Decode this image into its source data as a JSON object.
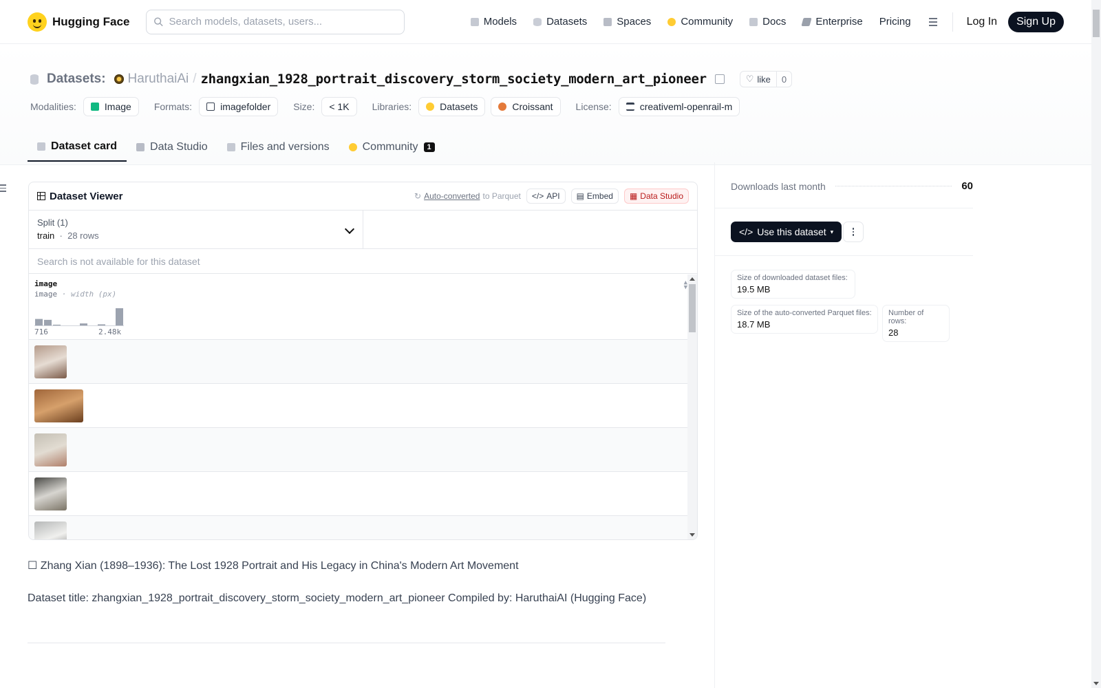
{
  "nav": {
    "brand": "Hugging Face",
    "search_placeholder": "Search models, datasets, users...",
    "links": [
      {
        "label": "Models",
        "icon": "models-icon"
      },
      {
        "label": "Datasets",
        "icon": "datasets-icon"
      },
      {
        "label": "Spaces",
        "icon": "spaces-icon"
      },
      {
        "label": "Community",
        "icon": "community-icon"
      },
      {
        "label": "Docs",
        "icon": "docs-icon"
      },
      {
        "label": "Enterprise",
        "icon": "enterprise-icon"
      },
      {
        "label": "Pricing",
        "icon": ""
      }
    ],
    "login": "Log In",
    "signup": "Sign Up"
  },
  "header": {
    "crumb_label": "Datasets:",
    "owner": "HaruthaiAi",
    "separator": "/",
    "repo": "zhangxian_1928_portrait_discovery_storm_society_modern_art_pioneer",
    "like_label": "like",
    "like_count": "0"
  },
  "tags": {
    "modalities_label": "Modalities:",
    "modality": "Image",
    "formats_label": "Formats:",
    "format": "imagefolder",
    "size_label": "Size:",
    "size": "< 1K",
    "libraries_label": "Libraries:",
    "libraries": [
      "Datasets",
      "Croissant"
    ],
    "license_label": "License:",
    "license": "creativeml-openrail-m"
  },
  "tabs": [
    {
      "label": "Dataset card",
      "active": true
    },
    {
      "label": "Data Studio",
      "active": false
    },
    {
      "label": "Files and versions",
      "active": false
    },
    {
      "label": "Community",
      "active": false,
      "badge": "1"
    }
  ],
  "viewer": {
    "title": "Dataset Viewer",
    "auto_converted": "Auto-converted",
    "to_parquet": "to Parquet",
    "api": "API",
    "embed": "Embed",
    "data_studio": "Data Studio",
    "split_label": "Split (1)",
    "split_value": "train",
    "split_dot": "·",
    "rows_label": "28 rows",
    "search_disabled": "Search is not available for this dataset",
    "column": {
      "name": "image",
      "type": "image",
      "stat": "· width (px)",
      "min_label": "716",
      "max_label": "2.48k",
      "histogram": [
        0.4,
        0.35,
        0.08,
        0,
        0,
        0.15,
        0,
        0.1,
        0,
        1.0
      ]
    },
    "thumbnails": [
      {
        "width": 47,
        "colors": [
          "#b49a8a",
          "#e6dcd3",
          "#7b5a48"
        ]
      },
      {
        "width": 71,
        "colors": [
          "#a0663a",
          "#d6a06b",
          "#6a3e1e"
        ]
      },
      {
        "width": 47,
        "colors": [
          "#c4bfb4",
          "#e2dcd2",
          "#b07f6a"
        ]
      },
      {
        "width": 47,
        "colors": [
          "#4a4a46",
          "#d7d5d0",
          "#7b7466"
        ]
      },
      {
        "width": 47,
        "colors": [
          "#b6b8b8",
          "#f0f0ee",
          "#707070"
        ]
      }
    ]
  },
  "card": {
    "line1": "☐ Zhang Xian (1898–1936): The Lost 1928 Portrait and His Legacy in China's Modern Art Movement",
    "line2": "Dataset title: zhangxian_1928_portrait_discovery_storm_society_modern_art_pioneer Compiled by: HaruthaiAI (Hugging Face)"
  },
  "sidebar": {
    "downloads_label": "Downloads last month",
    "downloads_value": "60",
    "use_button": "Use this dataset",
    "stats": [
      {
        "label": "Size of downloaded dataset files:",
        "value": "19.5 MB"
      },
      {
        "label": "Size of the auto-converted Parquet files:",
        "value": "18.7 MB"
      },
      {
        "label": "Number of rows:",
        "value": "28"
      }
    ]
  }
}
